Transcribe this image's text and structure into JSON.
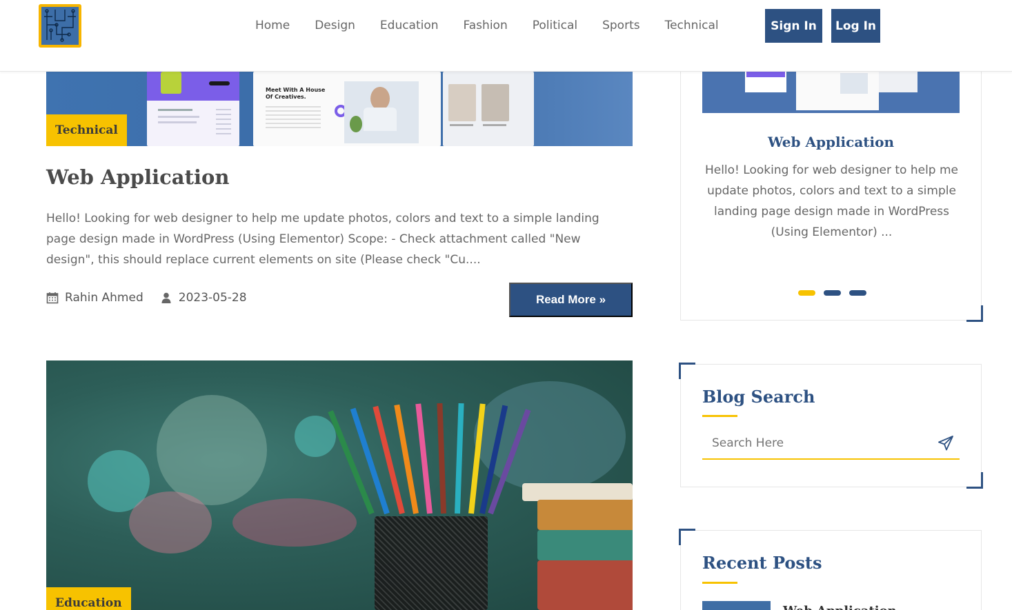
{
  "nav": {
    "items": [
      "Home",
      "Design",
      "Education",
      "Fashion",
      "Political",
      "Sports",
      "Technical"
    ],
    "sign_in": "Sign In",
    "log_in": "Log In"
  },
  "post1": {
    "category": "Technical",
    "image_caption": "Meet With A House Of Creatives.",
    "title": "Web Application",
    "excerpt": "Hello! Looking for web designer to help me update photos, colors and text to a simple landing page design made in WordPress (Using Elementor) Scope: - Check attachment called \"New design\", this should replace current elements on site (Please check \"Cu....",
    "author": "Rahin Ahmed",
    "date": "2023-05-28",
    "read_more": "Read More »"
  },
  "post2": {
    "category": "Education"
  },
  "sidebar": {
    "slider": {
      "title": "Web Application",
      "text": "Hello! Looking for web designer to help me update photos, colors and text to a simple landing page design made in WordPress (Using Elementor) ...",
      "dots": 3,
      "active_dot": 0
    },
    "blog_search": {
      "heading": "Blog Search",
      "placeholder": "Search Here"
    },
    "recent_posts": {
      "heading": "Recent Posts",
      "first_title": "Web Application"
    }
  },
  "colors": {
    "primary": "#2d5182",
    "accent": "#f7c200"
  }
}
